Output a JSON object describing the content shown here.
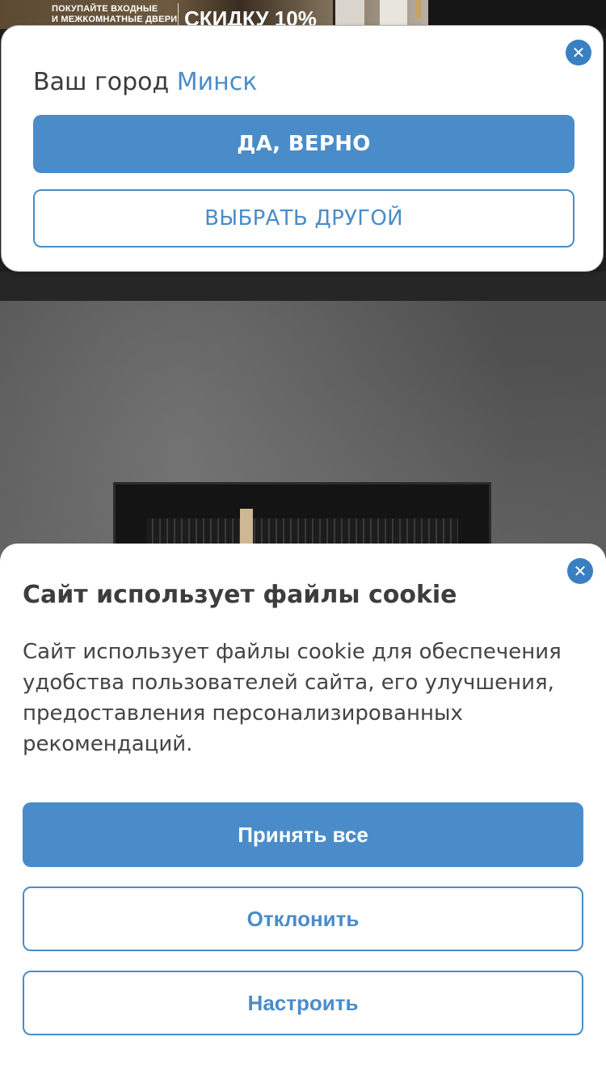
{
  "promo": {
    "small_text": "ПОКУПАЙТЕ ВХОДНЫЕ\nИ МЕЖКОМНАТНЫЕ ДВЕРИ",
    "big_text": "СКИДКУ 10%"
  },
  "city_modal": {
    "title_prefix": "Ваш город",
    "city": "Минск",
    "confirm_label": "ДА, ВЕРНО",
    "choose_other_label": "ВЫБРАТЬ ДРУГОЙ",
    "close_icon": "close-icon"
  },
  "cookie": {
    "title": "Сайт использует файлы cookie",
    "text": "Сайт использует файлы cookie для обеспечения удобства пользователей сайта, его улучшения, предоставления персонализированных рекомендаций.",
    "accept_label": "Принять все",
    "reject_label": "Отклонить",
    "settings_label": "Настроить",
    "close_icon": "close-icon"
  },
  "colors": {
    "accent": "#4a8cc9",
    "close_button": "#3a7fc1",
    "text": "#3a3a3a"
  }
}
